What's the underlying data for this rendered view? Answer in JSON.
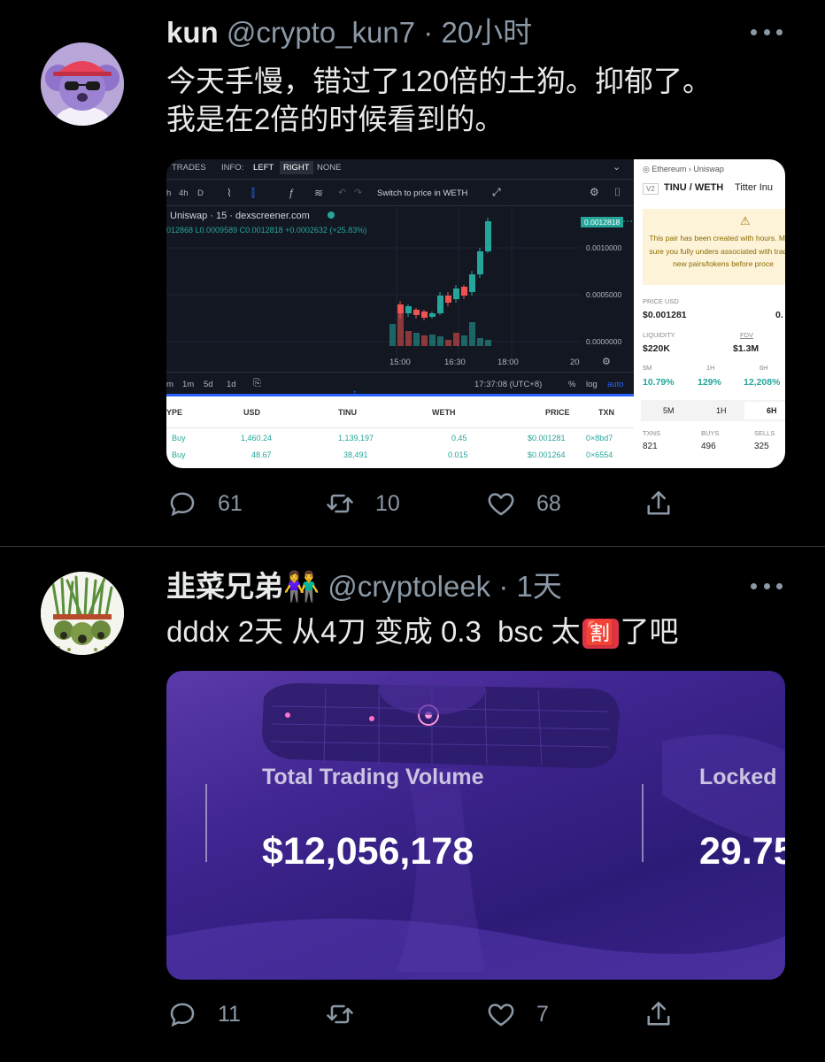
{
  "tweets": [
    {
      "name": "kun",
      "handle": "@crypto_kun7",
      "time": "· 20小时",
      "text_line1": "今天手慢，错过了120倍的土狗。抑郁了。",
      "text_line2": "我是在2倍的时候看到的。",
      "replies": "61",
      "retweets": "10",
      "likes": "68"
    },
    {
      "name": "韭菜兄弟",
      "name_emoji": "👫",
      "handle": "@cryptoleek",
      "time": "· 1天",
      "text": "dddx 2天 从4刀 变成 0.3  bsc 太",
      "text_emoji": "🈹",
      "text_end": "了吧",
      "replies": "11",
      "retweets": "",
      "likes": "7"
    }
  ],
  "chart_screenshot": {
    "tabs": [
      "TRADES",
      "INFO:",
      "LEFT",
      "RIGHT",
      "NONE"
    ],
    "timeframes": [
      "h",
      "4h",
      "D"
    ],
    "switch_label": "Switch to price in WETH",
    "pair_title": "Uniswap · 15 · dexscreener.com",
    "ohlc": "012868  L0.0009589  C0.0012818  +0.0002632 (+25.83%)",
    "price_labels": [
      "0.0012818",
      "0.0010000",
      "0.0005000",
      "0.0000000"
    ],
    "time_labels": [
      "15:00",
      "16:30",
      "18:00",
      "20"
    ],
    "ranges": [
      "m",
      "1m",
      "5d",
      "1d"
    ],
    "clock": "17:37:08 (UTC+8)",
    "scale_opts": [
      "%",
      "log",
      "auto"
    ],
    "columns": [
      "YPE",
      "USD",
      "TINU",
      "WETH",
      "PRICE",
      "TXN"
    ],
    "rows": [
      [
        "Buy",
        "1,460.24",
        "1,139,197",
        "0.45",
        "$0.001281",
        "0×8bd7"
      ],
      [
        "Buy",
        "48.67",
        "38,491",
        "0.015",
        "$0.001264",
        "0×6554"
      ]
    ],
    "breadcrumb_chain": "Ethereum",
    "breadcrumb_dex": "Uniswap",
    "version": "V2",
    "pair": "TINU / WETH",
    "pair_name": "Titter Inu",
    "warning": "This pair has been created with hours. Make sure you fully unders associated with trading new pairs/tokens before proce",
    "price_usd_label": "PRICE USD",
    "price_usd": "$0.001281",
    "price_native": "0.",
    "liquidity_label": "LIQUIDITY",
    "liquidity": "$220K",
    "fdv_label": "FDV",
    "fdv": "$1.3M",
    "changes": [
      {
        "label": "5M",
        "value": "10.79%"
      },
      {
        "label": "1H",
        "value": "129%"
      },
      {
        "label": "6H",
        "value": "12,208%"
      }
    ],
    "period_tabs": [
      "5M",
      "1H",
      "6H"
    ],
    "stats": [
      {
        "label": "TXNS",
        "value": "821"
      },
      {
        "label": "BUYS",
        "value": "496"
      },
      {
        "label": "SELLS",
        "value": "325"
      }
    ]
  },
  "dex_card": {
    "label1": "Total Trading Volume",
    "value1": "$12,056,178",
    "label2": "Locked",
    "value2": "29.75"
  },
  "colors": {
    "background": "#000000",
    "muted": "#8b98a5",
    "green": "#26a69a",
    "red": "#ef5350"
  }
}
